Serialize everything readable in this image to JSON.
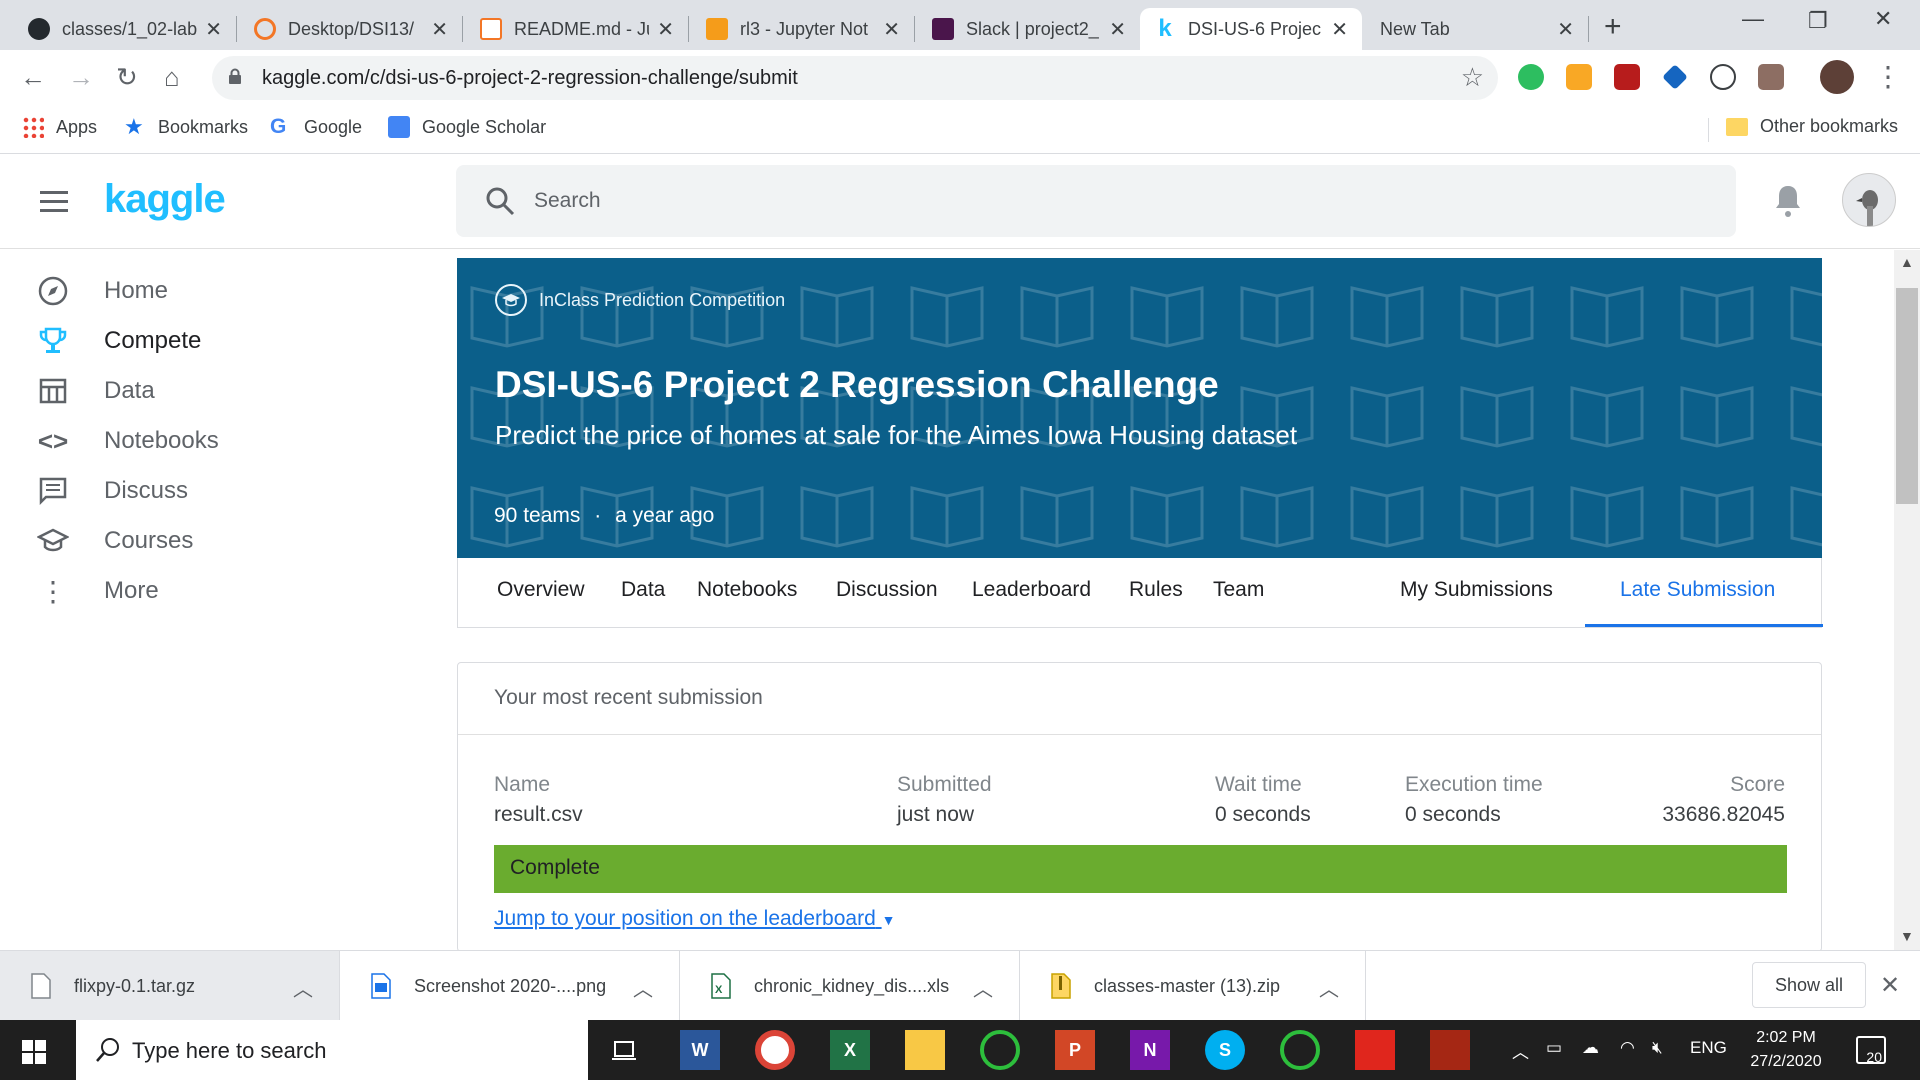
{
  "browser": {
    "tabs": [
      {
        "title": "classes/1_02-lab",
        "icon": "github-icon"
      },
      {
        "title": "Desktop/DSI13/",
        "icon": "jupyter-icon"
      },
      {
        "title": "README.md - Ju",
        "icon": "file-icon"
      },
      {
        "title": "rl3 - Jupyter Not",
        "icon": "book-icon"
      },
      {
        "title": "Slack | project2_",
        "icon": "slack-icon"
      },
      {
        "title": "DSI-US-6 Projec",
        "icon": "kaggle-icon"
      },
      {
        "title": "New Tab",
        "icon": ""
      }
    ],
    "url": "kaggle.com/c/dsi-us-6-project-2-regression-challenge/submit",
    "bookmarks": [
      "Apps",
      "Bookmarks",
      "Google",
      "Google Scholar"
    ],
    "other_bookmarks": "Other bookmarks"
  },
  "kaggle": {
    "logo": "kaggle",
    "search_placeholder": "Search",
    "nav": [
      "Home",
      "Compete",
      "Data",
      "Notebooks",
      "Discuss",
      "Courses",
      "More"
    ]
  },
  "competition": {
    "type": "InClass Prediction Competition",
    "title": "DSI-US-6 Project 2 Regression Challenge",
    "subtitle": "Predict the price of homes at sale for the Aimes Iowa Housing dataset",
    "teams": "90 teams",
    "separator": "·",
    "age": "a year ago",
    "tabs": [
      "Overview",
      "Data",
      "Notebooks",
      "Discussion",
      "Leaderboard",
      "Rules",
      "Team",
      "My Submissions",
      "Late Submission"
    ]
  },
  "submission": {
    "heading": "Your most recent submission",
    "labels": {
      "name": "Name",
      "submitted": "Submitted",
      "wait": "Wait time",
      "exec": "Execution time",
      "score": "Score"
    },
    "values": {
      "name": "result.csv",
      "submitted": "just now",
      "wait": "0 seconds",
      "exec": "0 seconds",
      "score": "33686.82045"
    },
    "status": "Complete",
    "jump_link": "Jump to your position on the leaderboard"
  },
  "downloads": {
    "items": [
      "flixpy-0.1.tar.gz",
      "Screenshot 2020-....png",
      "chronic_kidney_dis....xls",
      "classes-master (13).zip"
    ],
    "show_all": "Show all"
  },
  "taskbar": {
    "search_placeholder": "Type here to search",
    "lang": "ENG",
    "time": "2:02 PM",
    "date": "27/2/2020",
    "notifications": "20"
  },
  "colors": {
    "kaggle_blue": "#20beff",
    "banner": "#0b5f8a",
    "status_green": "#6aac2f",
    "active_tab": "#1a73e8"
  }
}
